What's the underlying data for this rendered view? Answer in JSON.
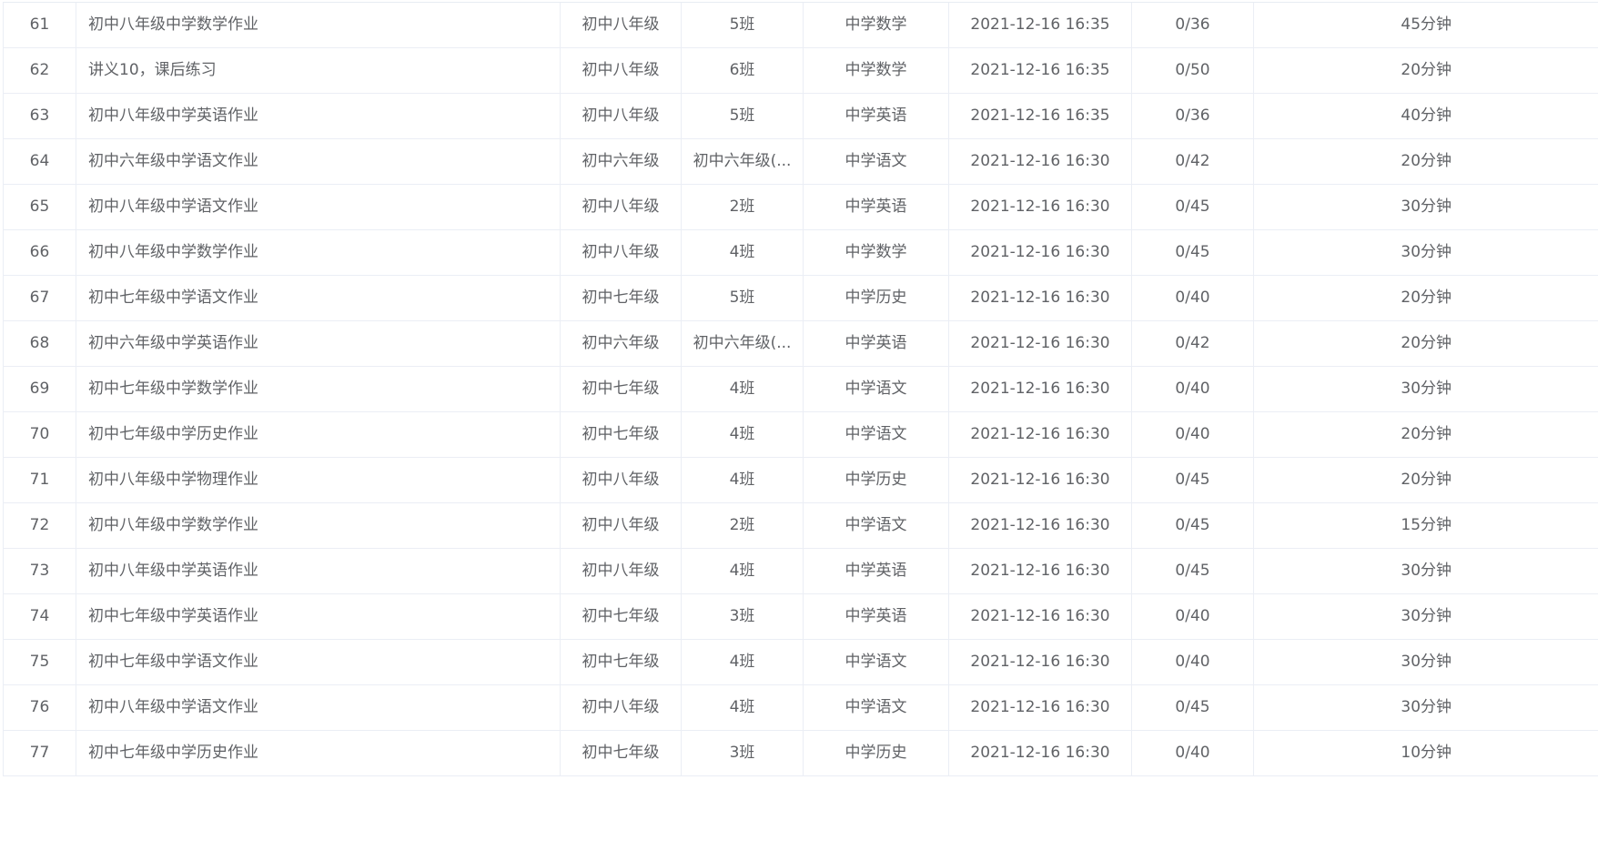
{
  "table": {
    "rows": [
      {
        "index": "61",
        "title": "初中八年级中学数学作业",
        "grade": "初中八年级",
        "class": "5班",
        "subject": "中学数学",
        "time": "2021-12-16 16:35",
        "submitted": "0/36",
        "duration": "45分钟"
      },
      {
        "index": "62",
        "title": "讲义10，课后练习",
        "grade": "初中八年级",
        "class": "6班",
        "subject": "中学数学",
        "time": "2021-12-16 16:35",
        "submitted": "0/50",
        "duration": "20分钟"
      },
      {
        "index": "63",
        "title": "初中八年级中学英语作业",
        "grade": "初中八年级",
        "class": "5班",
        "subject": "中学英语",
        "time": "2021-12-16 16:35",
        "submitted": "0/36",
        "duration": "40分钟"
      },
      {
        "index": "64",
        "title": "初中六年级中学语文作业",
        "grade": "初中六年级",
        "class": "初中六年级(...",
        "subject": "中学语文",
        "time": "2021-12-16 16:30",
        "submitted": "0/42",
        "duration": "20分钟"
      },
      {
        "index": "65",
        "title": "初中八年级中学语文作业",
        "grade": "初中八年级",
        "class": "2班",
        "subject": "中学英语",
        "time": "2021-12-16 16:30",
        "submitted": "0/45",
        "duration": "30分钟"
      },
      {
        "index": "66",
        "title": "初中八年级中学数学作业",
        "grade": "初中八年级",
        "class": "4班",
        "subject": "中学数学",
        "time": "2021-12-16 16:30",
        "submitted": "0/45",
        "duration": "30分钟"
      },
      {
        "index": "67",
        "title": "初中七年级中学语文作业",
        "grade": "初中七年级",
        "class": "5班",
        "subject": "中学历史",
        "time": "2021-12-16 16:30",
        "submitted": "0/40",
        "duration": "20分钟"
      },
      {
        "index": "68",
        "title": "初中六年级中学英语作业",
        "grade": "初中六年级",
        "class": "初中六年级(...",
        "subject": "中学英语",
        "time": "2021-12-16 16:30",
        "submitted": "0/42",
        "duration": "20分钟"
      },
      {
        "index": "69",
        "title": "初中七年级中学数学作业",
        "grade": "初中七年级",
        "class": "4班",
        "subject": "中学语文",
        "time": "2021-12-16 16:30",
        "submitted": "0/40",
        "duration": "30分钟"
      },
      {
        "index": "70",
        "title": "初中七年级中学历史作业",
        "grade": "初中七年级",
        "class": "4班",
        "subject": "中学语文",
        "time": "2021-12-16 16:30",
        "submitted": "0/40",
        "duration": "20分钟"
      },
      {
        "index": "71",
        "title": "初中八年级中学物理作业",
        "grade": "初中八年级",
        "class": "4班",
        "subject": "中学历史",
        "time": "2021-12-16 16:30",
        "submitted": "0/45",
        "duration": "20分钟"
      },
      {
        "index": "72",
        "title": "初中八年级中学数学作业",
        "grade": "初中八年级",
        "class": "2班",
        "subject": "中学语文",
        "time": "2021-12-16 16:30",
        "submitted": "0/45",
        "duration": "15分钟"
      },
      {
        "index": "73",
        "title": "初中八年级中学英语作业",
        "grade": "初中八年级",
        "class": "4班",
        "subject": "中学英语",
        "time": "2021-12-16 16:30",
        "submitted": "0/45",
        "duration": "30分钟"
      },
      {
        "index": "74",
        "title": "初中七年级中学英语作业",
        "grade": "初中七年级",
        "class": "3班",
        "subject": "中学英语",
        "time": "2021-12-16 16:30",
        "submitted": "0/40",
        "duration": "30分钟"
      },
      {
        "index": "75",
        "title": "初中七年级中学语文作业",
        "grade": "初中七年级",
        "class": "4班",
        "subject": "中学语文",
        "time": "2021-12-16 16:30",
        "submitted": "0/40",
        "duration": "30分钟"
      },
      {
        "index": "76",
        "title": "初中八年级中学语文作业",
        "grade": "初中八年级",
        "class": "4班",
        "subject": "中学语文",
        "time": "2021-12-16 16:30",
        "submitted": "0/45",
        "duration": "30分钟"
      },
      {
        "index": "77",
        "title": "初中七年级中学历史作业",
        "grade": "初中七年级",
        "class": "3班",
        "subject": "中学历史",
        "time": "2021-12-16 16:30",
        "submitted": "0/40",
        "duration": "10分钟"
      }
    ]
  },
  "colors": {
    "text": "#606266",
    "border": "#ebeef5",
    "background": "#ffffff"
  }
}
